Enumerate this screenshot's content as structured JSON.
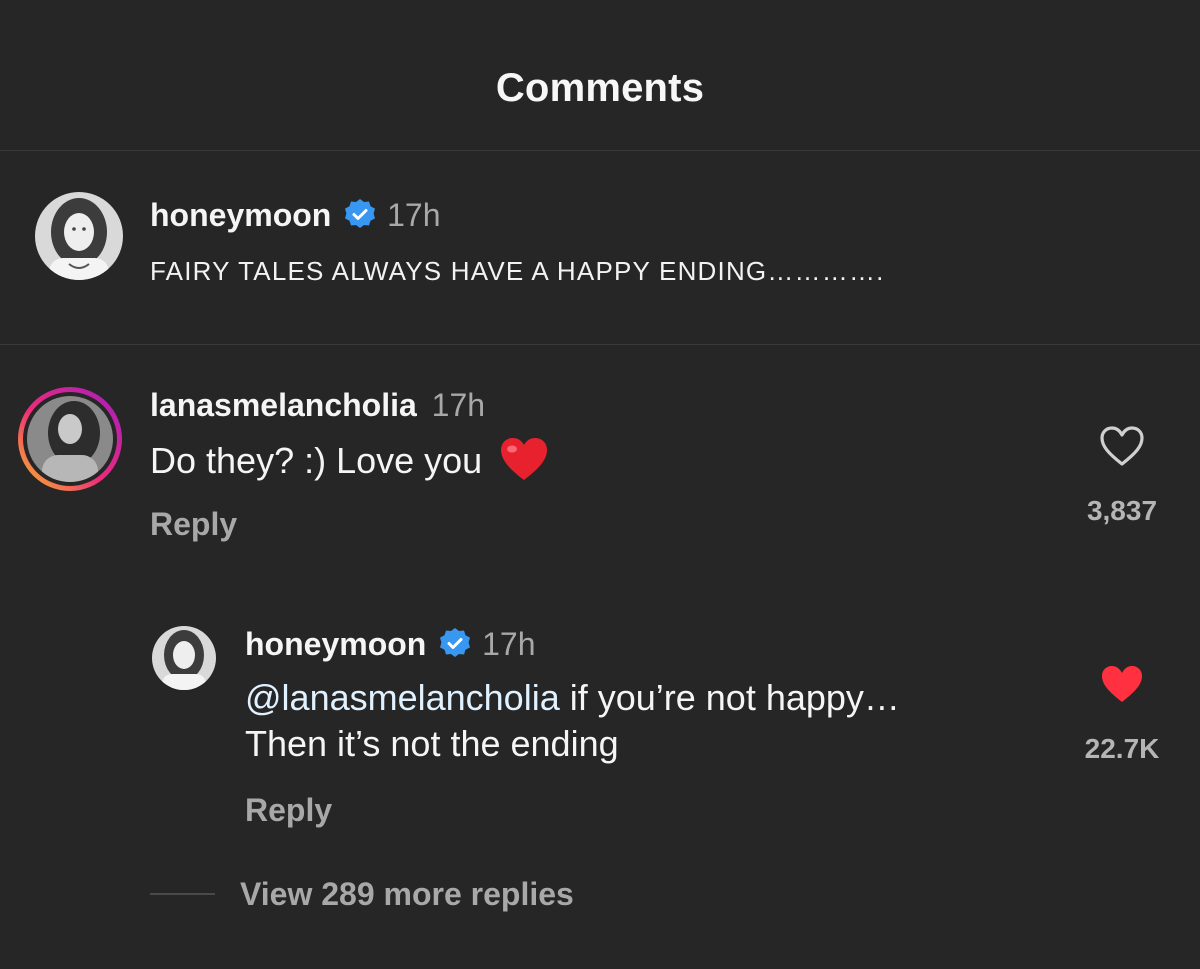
{
  "header": {
    "title": "Comments"
  },
  "caption": {
    "username": "honeymoon",
    "verified": true,
    "time": "17h",
    "text": "FAIRY TALES ALWAYS HAVE A HAPPY ENDING…………."
  },
  "comment": {
    "username": "lanasmelancholia",
    "time": "17h",
    "text": "Do they? :) Love you",
    "emoji": "❤️",
    "reply_label": "Reply",
    "like_count": "3,837",
    "liked": false
  },
  "reply": {
    "username": "honeymoon",
    "verified": true,
    "time": "17h",
    "mention": "@lanasmelancholia",
    "text_line1": " if you’re not happy…",
    "text_line2": "Then it’s not the ending",
    "reply_label": "Reply",
    "like_count": "22.7K",
    "liked": true
  },
  "view_more": {
    "label": "View 289 more replies"
  },
  "colors": {
    "background": "#262626",
    "verified_blue": "#3897f0",
    "like_red": "#ff3040",
    "muted_text": "#a8a8a8"
  },
  "icons": [
    "verified-badge-icon",
    "heart-outline-icon",
    "heart-filled-icon",
    "red-heart-emoji-icon"
  ]
}
